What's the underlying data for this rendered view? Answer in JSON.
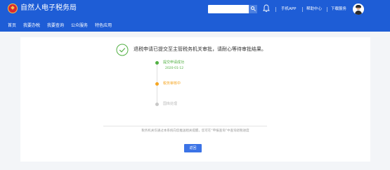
{
  "header": {
    "brand": "自然人电子税务局",
    "nav": [
      "首页",
      "我要办税",
      "我要查询",
      "公众服务",
      "特色应用"
    ],
    "search": {
      "value": "",
      "placeholder": ""
    },
    "links": {
      "mobile_app": "手机APP",
      "help_center": "帮助中心",
      "download": "下载服务"
    },
    "colors": {
      "bar": "#1e5dd6"
    }
  },
  "result": {
    "message": "退税申请已提交至主管税务机关审批，请耐心等待审批结果。",
    "timeline": [
      {
        "label": "提交申请成功",
        "date": "2020-01-12",
        "status": "done",
        "color": "#52b043"
      },
      {
        "label": "税务审核中",
        "date": "",
        "status": "current",
        "color": "#f5a623"
      },
      {
        "label": "国库处理",
        "date": "",
        "status": "pending",
        "color": "#c8c8c8"
      }
    ],
    "notice": "税务机关仅通过本系统向您推送相关提醒，您可在“申报查询”中查询退税进度",
    "return_button": "返回"
  }
}
